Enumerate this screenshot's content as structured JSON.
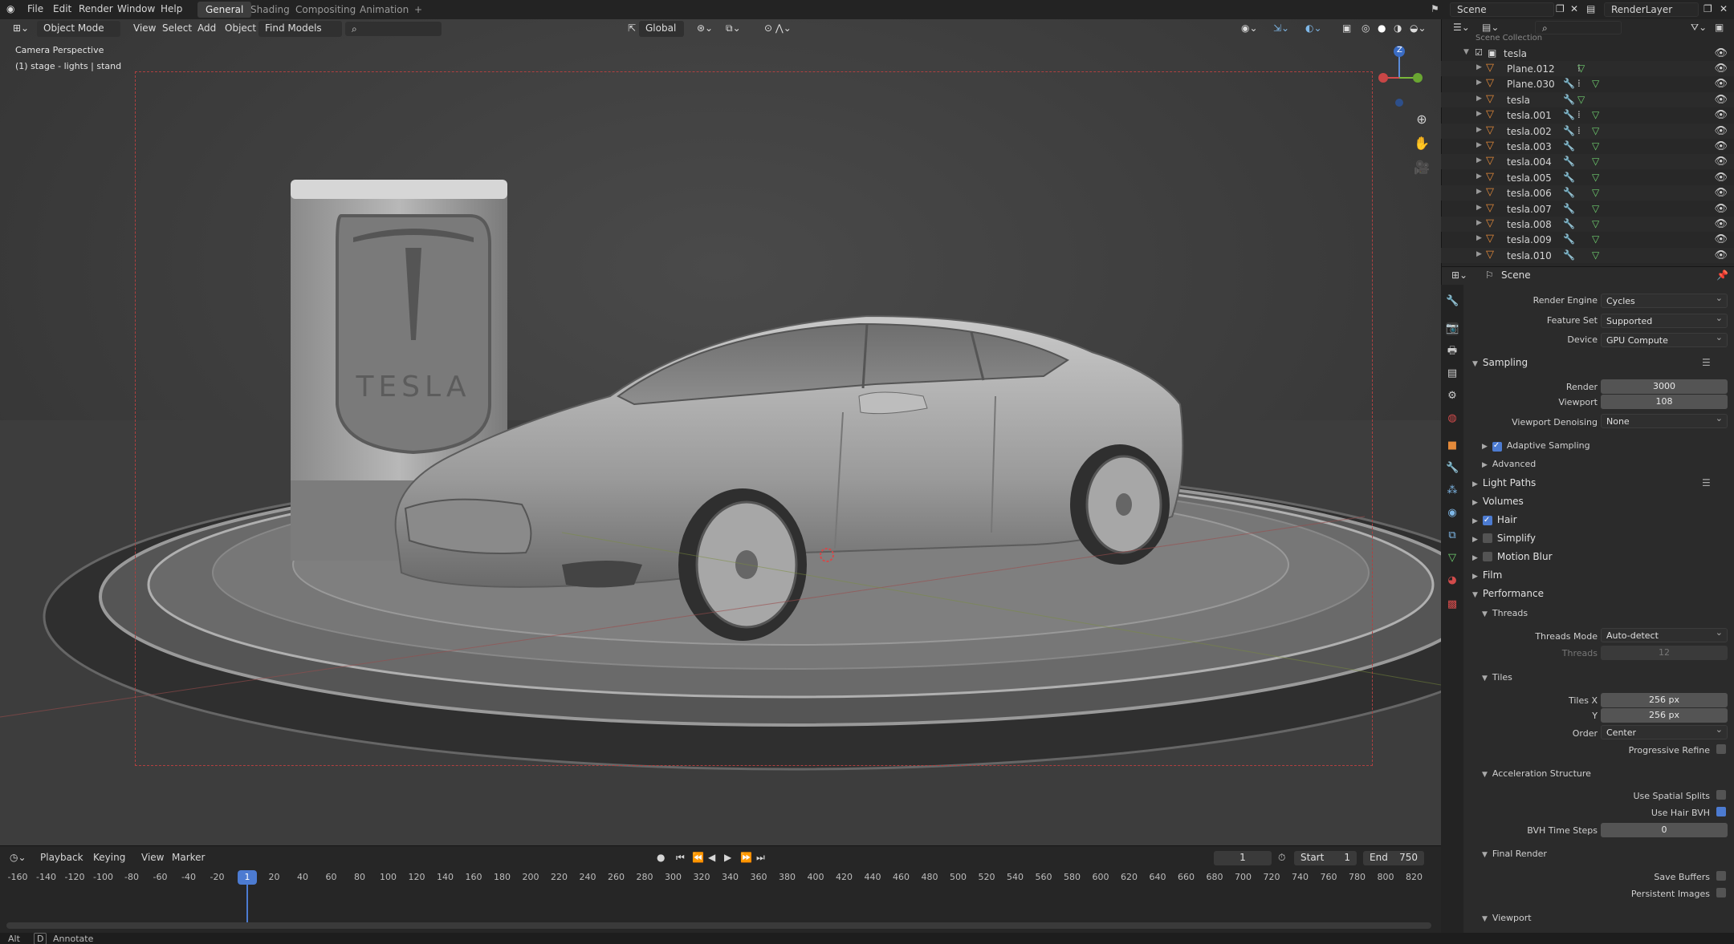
{
  "topbar": {
    "menus": [
      "File",
      "Edit",
      "Render",
      "Window",
      "Help"
    ],
    "workspaces": [
      "General",
      "Shading",
      "Compositing",
      "Animation"
    ],
    "active_workspace": "General",
    "add_workspace": "+",
    "scene_name": "Scene",
    "view_layer": "RenderLayer"
  },
  "viewport": {
    "mode": "Object Mode",
    "menus": [
      "View",
      "Select",
      "Add",
      "Object"
    ],
    "find_models": "Find Models",
    "transform_orientation": "Global",
    "camera_label": "Camera Perspective",
    "collection_label": "(1) stage - lights | stand",
    "gizmo_z": "Z"
  },
  "timeline": {
    "menus": [
      "Playback",
      "Keying",
      "View",
      "Marker"
    ],
    "current_frame": "1",
    "start_label": "Start",
    "start": "1",
    "end_label": "End",
    "end": "750",
    "playhead": "1",
    "ticks": [
      "-160",
      "-140",
      "-120",
      "-100",
      "-80",
      "-60",
      "-40",
      "-20",
      "20",
      "40",
      "60",
      "80",
      "100",
      "120",
      "140",
      "160",
      "180",
      "200",
      "220",
      "240",
      "260",
      "280",
      "300",
      "320",
      "340",
      "360",
      "380",
      "400",
      "420",
      "440",
      "460",
      "480",
      "500",
      "520",
      "540",
      "560",
      "580",
      "600",
      "620",
      "640",
      "660",
      "680",
      "700",
      "720",
      "740",
      "760",
      "780",
      "800",
      "820"
    ]
  },
  "statusbar": {
    "key": "Alt",
    "key2": "D",
    "action": "Annotate"
  },
  "outliner": {
    "header": "Scene Collection",
    "collection": "tesla",
    "items": [
      "Plane.012",
      "Plane.030",
      "tesla",
      "tesla.001",
      "tesla.002",
      "tesla.003",
      "tesla.004",
      "tesla.005",
      "tesla.006",
      "tesla.007",
      "tesla.008",
      "tesla.009",
      "tesla.010"
    ]
  },
  "properties": {
    "context": "Scene",
    "render_engine_label": "Render Engine",
    "render_engine": "Cycles",
    "feature_set_label": "Feature Set",
    "feature_set": "Supported",
    "device_label": "Device",
    "device": "GPU Compute",
    "sampling": "Sampling",
    "render_label": "Render",
    "render_samples": "3000",
    "viewport_label": "Viewport",
    "viewport_samples": "108",
    "viewport_denoising_label": "Viewport Denoising",
    "viewport_denoising": "None",
    "adaptive_sampling": "Adaptive Sampling",
    "advanced": "Advanced",
    "light_paths": "Light Paths",
    "volumes": "Volumes",
    "hair": "Hair",
    "simplify": "Simplify",
    "motion_blur": "Motion Blur",
    "film": "Film",
    "performance": "Performance",
    "threads": "Threads",
    "threads_mode_label": "Threads Mode",
    "threads_mode": "Auto-detect",
    "threads_label": "Threads",
    "threads_value": "12",
    "tiles": "Tiles",
    "tiles_x_label": "Tiles X",
    "tiles_x": "256 px",
    "tiles_y_label": "Y",
    "tiles_y": "256 px",
    "order_label": "Order",
    "order": "Center",
    "progressive_refine": "Progressive Refine",
    "acceleration_structure": "Acceleration Structure",
    "use_spatial_splits": "Use Spatial Splits",
    "use_hair_bvh": "Use Hair BVH",
    "bvh_time_steps_label": "BVH Time Steps",
    "bvh_time_steps": "0",
    "final_render": "Final Render",
    "save_buffers": "Save Buffers",
    "persistent_images": "Persistent Images",
    "viewport_section": "Viewport"
  },
  "colors": {
    "accent": "#4c7bd1",
    "mesh_orange": "#e48a3a",
    "camera_border": "#b04040"
  }
}
